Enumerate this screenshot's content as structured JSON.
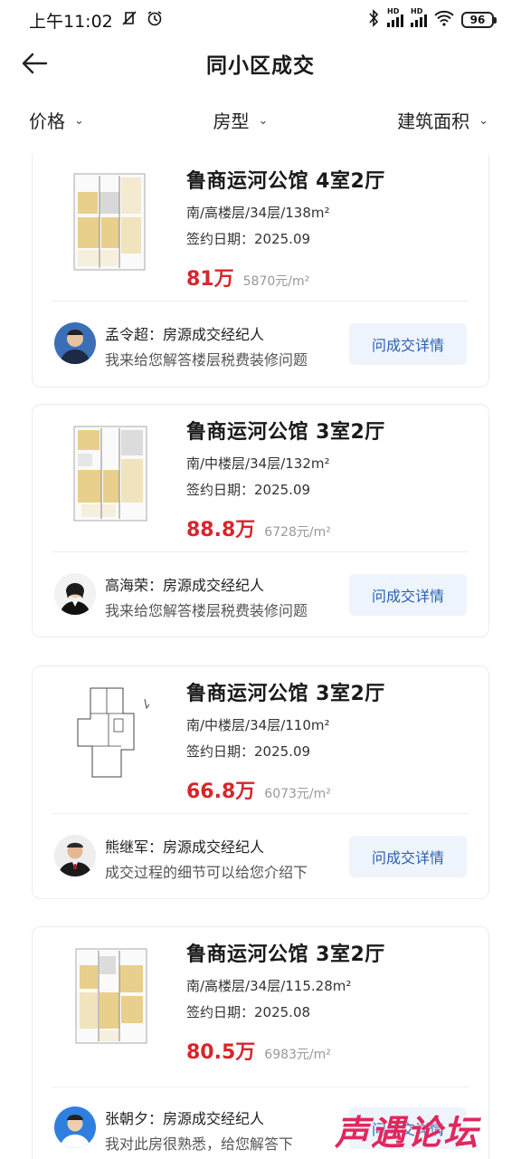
{
  "status_bar": {
    "time": "上午11:02",
    "battery": "96",
    "hd1": "HD",
    "hd2": "HD"
  },
  "header": {
    "title": "同小区成交"
  },
  "filters": [
    {
      "label": "价格"
    },
    {
      "label": "房型"
    },
    {
      "label": "建筑面积"
    }
  ],
  "listings": [
    {
      "title": "鲁商运河公馆 4室2厅",
      "detail": "南/高楼层/34层/138m²",
      "sign_date": "签约日期：2025.09",
      "price": "81万",
      "unit_price": "5870元/m²",
      "agent_name": "孟令超：房源成交经纪人",
      "agent_msg": "我来给您解答楼层税费装修问题",
      "button": "问成交详情"
    },
    {
      "title": "鲁商运河公馆 3室2厅",
      "detail": "南/中楼层/34层/132m²",
      "sign_date": "签约日期：2025.09",
      "price": "88.8万",
      "unit_price": "6728元/m²",
      "agent_name": "高海荣：房源成交经纪人",
      "agent_msg": "我来给您解答楼层税费装修问题",
      "button": "问成交详情"
    },
    {
      "title": "鲁商运河公馆 3室2厅",
      "detail": "南/中楼层/34层/110m²",
      "sign_date": "签约日期：2025.09",
      "price": "66.8万",
      "unit_price": "6073元/m²",
      "agent_name": "熊继军：房源成交经纪人",
      "agent_msg": "成交过程的细节可以给您介绍下",
      "button": "问成交详情"
    },
    {
      "title": "鲁商运河公馆 3室2厅",
      "detail": "南/高楼层/34层/115.28m²",
      "sign_date": "签约日期：2025.08",
      "price": "80.5万",
      "unit_price": "6983元/m²",
      "agent_name": "张朝夕：房源成交经纪人",
      "agent_msg": "我对此房很熟悉，给您解答下",
      "button": "问成交详情"
    }
  ],
  "watermark": "声遇论坛",
  "colors": {
    "price": "#d6262b",
    "button_bg": "#eef4fc",
    "button_text": "#2a5fb0"
  }
}
